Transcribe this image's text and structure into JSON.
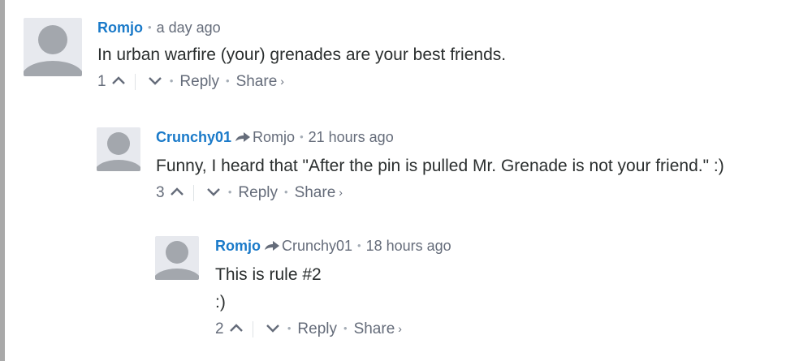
{
  "thread": {
    "comments": [
      {
        "author": "Romjo",
        "parent": "",
        "time": "a day ago",
        "lines": [
          "In urban warfire (your) grenades are your best friends."
        ],
        "votes": "1",
        "reply_label": "Reply",
        "share_label": "Share"
      },
      {
        "author": "Crunchy01",
        "parent": "Romjo",
        "time": "21 hours ago",
        "lines": [
          "Funny, I heard that \"After the pin is pulled Mr. Grenade is not your friend.\" :)"
        ],
        "votes": "3",
        "reply_label": "Reply",
        "share_label": "Share"
      },
      {
        "author": "Romjo",
        "parent": "Crunchy01",
        "time": "18 hours ago",
        "lines": [
          "This is rule #2",
          ":)"
        ],
        "votes": "2",
        "reply_label": "Reply",
        "share_label": "Share"
      }
    ]
  },
  "icons": {
    "avatar": "default-avatar-icon",
    "reply_to": "reply-arrow-icon",
    "upvote": "chevron-up-icon",
    "downvote": "chevron-down-icon",
    "share_caret": "chevron-right-icon"
  },
  "colors": {
    "author": "#1a7ac9",
    "meta": "#656c7a",
    "text": "#2a2e2e",
    "avatar_bg": "#e7e9ee",
    "avatar_fg": "#a3a7ad"
  }
}
